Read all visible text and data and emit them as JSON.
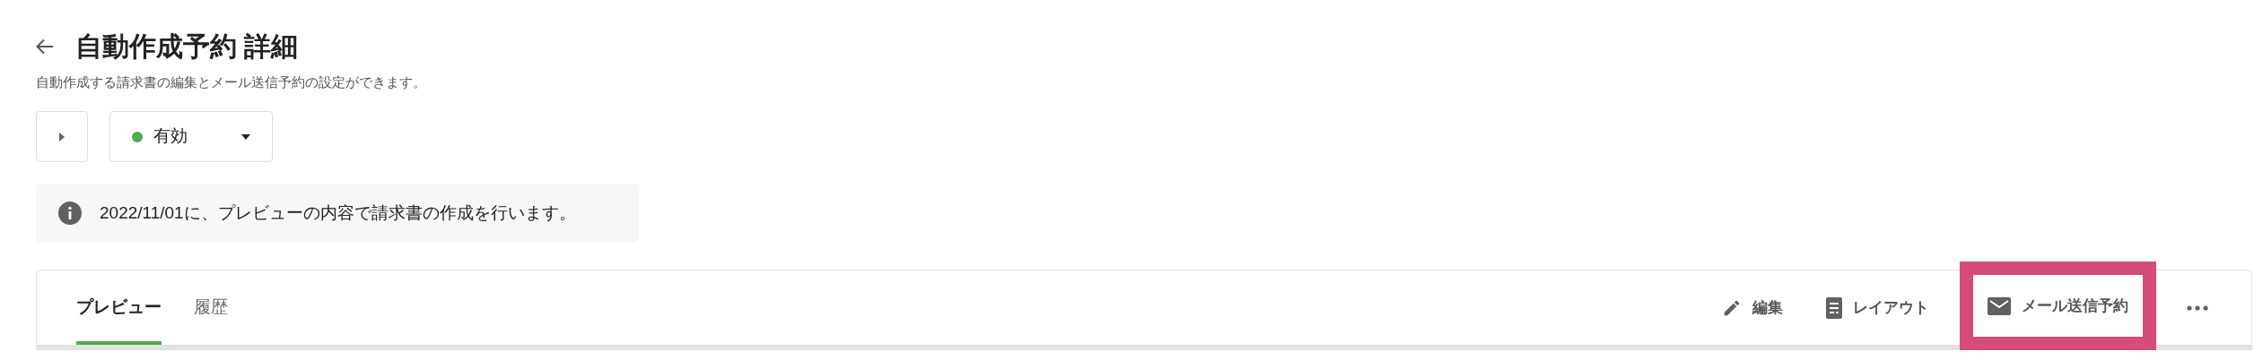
{
  "header": {
    "title": "自動作成予約 詳細",
    "subtitle": "自動作成する請求書の編集とメール送信予約の設定ができます。"
  },
  "status": {
    "label": "有効",
    "color": "#4caf50"
  },
  "notice": {
    "text": "2022/11/01に、プレビューの内容で請求書の作成を行います。"
  },
  "tabs": [
    {
      "label": "プレビュー",
      "selected": true
    },
    {
      "label": "履歴",
      "selected": false
    }
  ],
  "actions": [
    {
      "kind": "edit",
      "label": "編集",
      "highlighted": false
    },
    {
      "kind": "layout",
      "label": "レイアウト",
      "highlighted": false
    },
    {
      "kind": "mail",
      "label": "メール送信予約",
      "highlighted": true
    },
    {
      "kind": "more",
      "highlighted": false
    }
  ]
}
